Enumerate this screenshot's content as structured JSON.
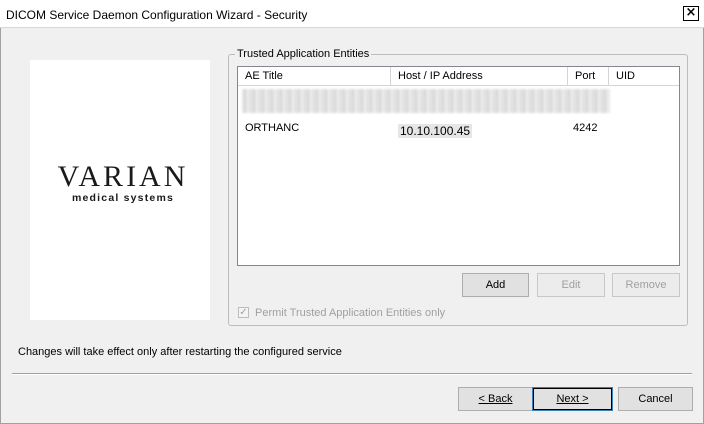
{
  "window": {
    "title": "DICOM Service Daemon Configuration Wizard  -  Security",
    "close_glyph": "×"
  },
  "logo": {
    "wordmark": "VARIAN",
    "subtitle": "medical systems"
  },
  "trusted_group": {
    "label": "Trusted Application Entities",
    "columns": [
      "AE Title",
      "Host / IP Address",
      "Port",
      "UID"
    ],
    "rows": [
      {
        "ae_title": "ORTHANC",
        "host": "10.10.100.45",
        "port": "4242",
        "uid": ""
      }
    ],
    "buttons": {
      "add": "Add",
      "edit": "Edit",
      "remove": "Remove"
    },
    "checkbox": {
      "label": "Permit Trusted Application Entities only",
      "checked": true,
      "enabled": false
    }
  },
  "notice": "Changes will take effect only after restarting the configured service",
  "footer": {
    "back_label": "< Back",
    "next_label": "Next >",
    "cancel_label": "Cancel"
  }
}
